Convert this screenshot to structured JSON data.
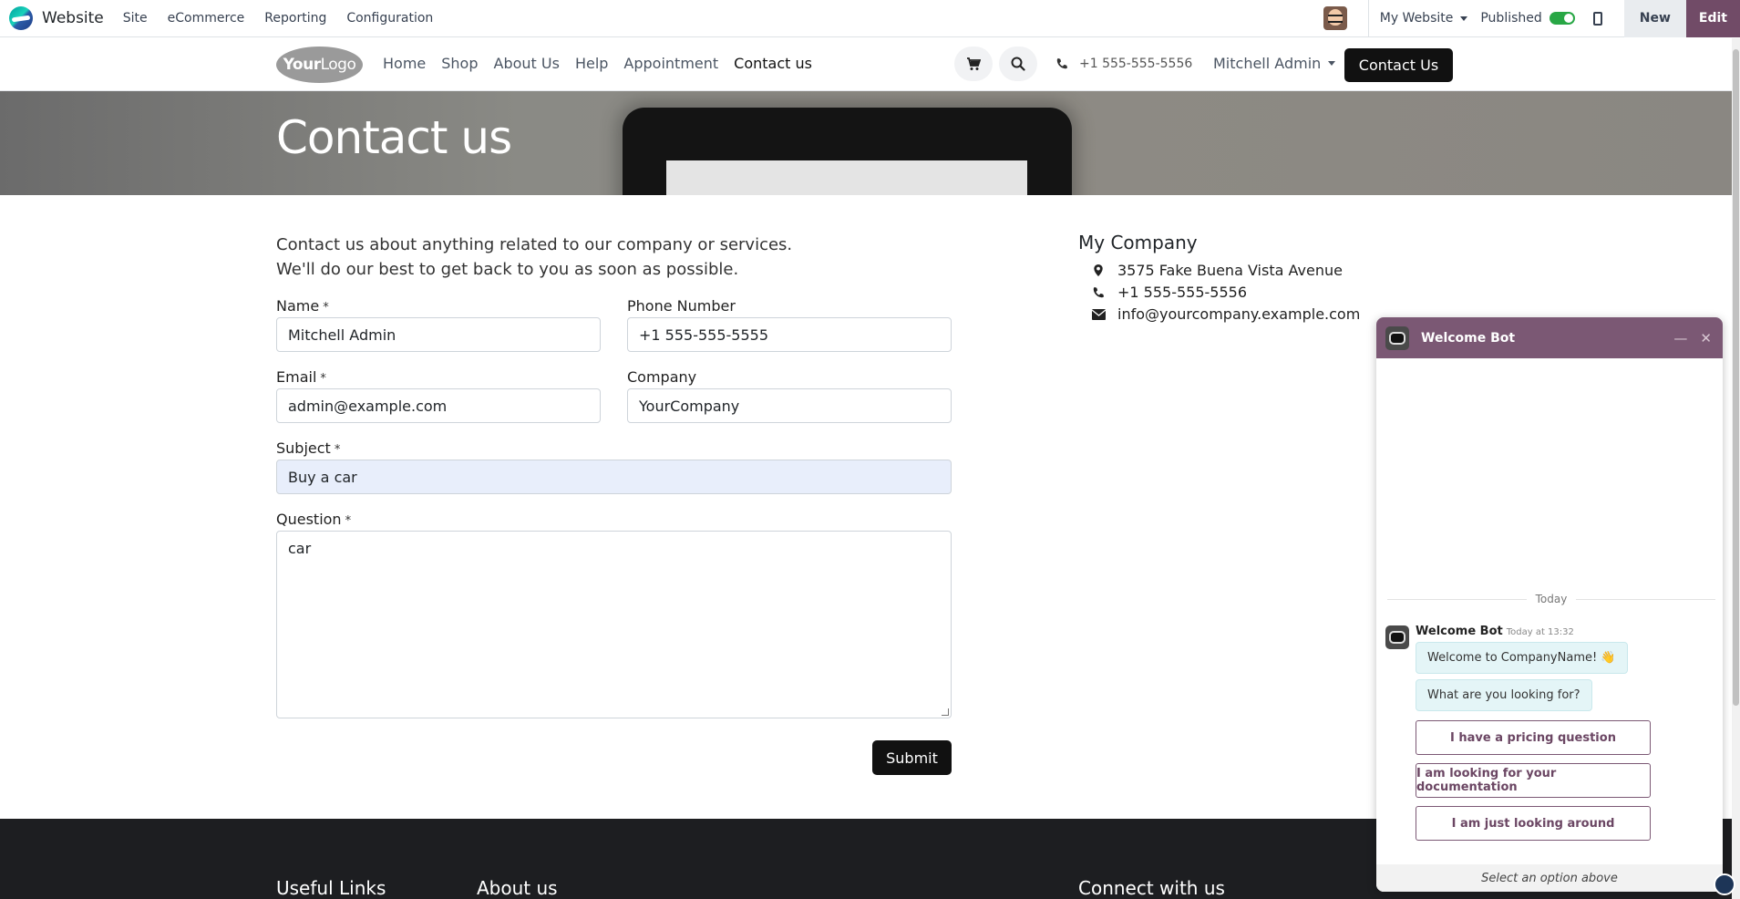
{
  "topbar": {
    "app_name": "Website",
    "menu": [
      "Site",
      "eCommerce",
      "Reporting",
      "Configuration"
    ],
    "website_selector": "My Website",
    "published_label": "Published",
    "new_label": "New",
    "edit_label": "Edit"
  },
  "header": {
    "logo_bold": "Your",
    "logo_rest": "Logo",
    "nav": [
      "Home",
      "Shop",
      "About Us",
      "Help",
      "Appointment",
      "Contact us"
    ],
    "phone": "+1 555-555-5556",
    "user": "Mitchell Admin",
    "cta": "Contact Us"
  },
  "banner": {
    "title": "Contact us"
  },
  "form": {
    "intro_line1": "Contact us about anything related to our company or services.",
    "intro_line2": "We'll do our best to get back to you as soon as possible.",
    "required_mark": "*",
    "name_label": "Name",
    "name_value": "Mitchell Admin",
    "phone_label": "Phone Number",
    "phone_value": "+1 555-555-5555",
    "email_label": "Email",
    "email_value": "admin@example.com",
    "company_label": "Company",
    "company_value": "YourCompany",
    "subject_label": "Subject",
    "subject_value": "Buy a car",
    "question_label": "Question",
    "question_value": "car",
    "submit_label": "Submit"
  },
  "company": {
    "name": "My Company",
    "address": "3575 Fake Buena Vista Avenue",
    "phone": "+1 555-555-5556",
    "email": "info@yourcompany.example.com"
  },
  "footer": {
    "col1": "Useful Links",
    "col2": "About us",
    "col3": "Connect with us"
  },
  "chat": {
    "title": "Welcome Bot",
    "day_separator": "Today",
    "author": "Welcome Bot",
    "time": "Today at 13:32",
    "messages": [
      "Welcome to CompanyName! 👋",
      "What are you looking for?"
    ],
    "options": [
      "I have a pricing question",
      "I am looking for your documentation",
      "I am just looking around"
    ],
    "footer_hint": "Select an option above"
  },
  "colors": {
    "brand_purple": "#714b67",
    "chat_header": "#7b5874",
    "toggle_on": "#28a745",
    "dark_button": "#111111",
    "footer_bg": "#1d1e21"
  }
}
